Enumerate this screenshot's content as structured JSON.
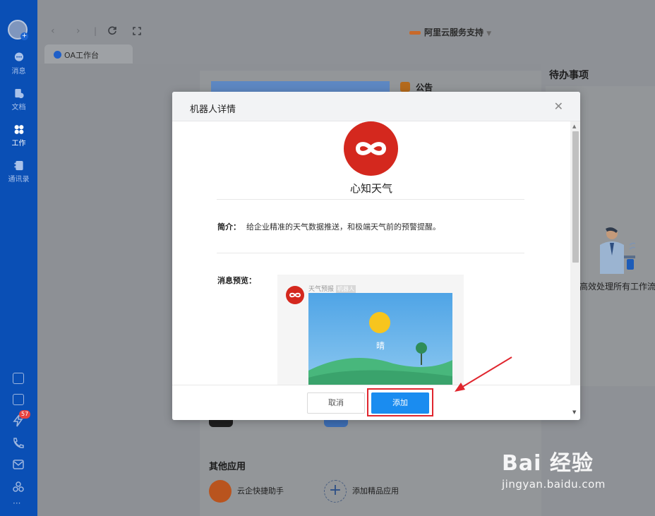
{
  "sidebar": {
    "items": [
      {
        "label": "消息"
      },
      {
        "label": "文档"
      },
      {
        "label": "工作"
      },
      {
        "label": "通讯录"
      }
    ],
    "badge_count": "57"
  },
  "topbar": {
    "org_name": "阿里云服务支持"
  },
  "tab": {
    "label": "OA工作台"
  },
  "background": {
    "notice_label": "公告",
    "todo_title": "待办事项",
    "todo_desc": "高效处理所有工作流",
    "other_apps_title": "其他应用",
    "apps": [
      {
        "label": "云企快捷助手"
      },
      {
        "label": "添加精品应用"
      }
    ]
  },
  "modal": {
    "title": "机器人详情",
    "bot_name": "心知天气",
    "intro_label": "简介：",
    "intro_text": "给企业精准的天气数据推送，和极端天气前的预警提醒。",
    "preview_label": "消息预览：",
    "preview_sender": "天气预报",
    "preview_tag": "机器人",
    "preview_weather": "晴",
    "cancel_label": "取消",
    "add_label": "添加"
  },
  "watermark": {
    "brand": "Bai 经验",
    "url": "jingyan.baidu.com"
  },
  "colors": {
    "sidebar_bg": "#0a4fb5",
    "primary_button": "#1a8cf0",
    "bot_red": "#d4281e",
    "highlight_red": "#e0262e"
  }
}
